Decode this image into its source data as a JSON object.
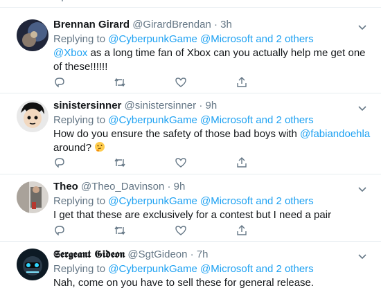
{
  "tweets": [
    {
      "name": "Brennan Girard",
      "handle": "@GirardBrendan",
      "dot": "·",
      "time": "3h",
      "replying_prefix": "Replying to",
      "replying_users": [
        "@CyberpunkGame",
        "@Microsoft"
      ],
      "replying_others": "and 2 others",
      "mention": "@Xbox",
      "text_after_mention": " as a long time fan of Xbox can you actually help me get one of these!!!!!!"
    },
    {
      "name": "sinistersinner",
      "handle": "@sinistersinner",
      "dot": "·",
      "time": "9h",
      "replying_prefix": "Replying to",
      "replying_users": [
        "@CyberpunkGame",
        "@Microsoft"
      ],
      "replying_others": "and 2 others",
      "text_before_mention": "How do you ensure the safety of those bad boys with ",
      "mention": "@fabiandoehla",
      "text_after_mention": " around? ",
      "emoji": "thinking-face"
    },
    {
      "name": "Theo",
      "handle": "@Theo_Davinson",
      "dot": "·",
      "time": "9h",
      "replying_prefix": "Replying to",
      "replying_users": [
        "@CyberpunkGame",
        "@Microsoft"
      ],
      "replying_others": "and 2 others",
      "text": "I get that these are exclusively for a contest but I need a pair"
    },
    {
      "name": "𝕾𝖊𝖗𝖌𝖊𝖆𝖓𝖙 𝕲𝖎𝖉𝖊𝖔𝖓",
      "handle": "@SgtGideon",
      "dot": "·",
      "time": "7h",
      "replying_prefix": "Replying to",
      "replying_users": [
        "@CyberpunkGame",
        "@Microsoft"
      ],
      "replying_others": "and 2 others",
      "text": "Nah, come on you have to sell these for general release."
    }
  ],
  "colors": {
    "link": "#1da1f2",
    "muted": "#657786",
    "text": "#14171a",
    "border": "#e6ecf0"
  },
  "icons": [
    "reply-icon",
    "retweet-icon",
    "like-icon",
    "share-icon",
    "chevron-down-icon"
  ]
}
